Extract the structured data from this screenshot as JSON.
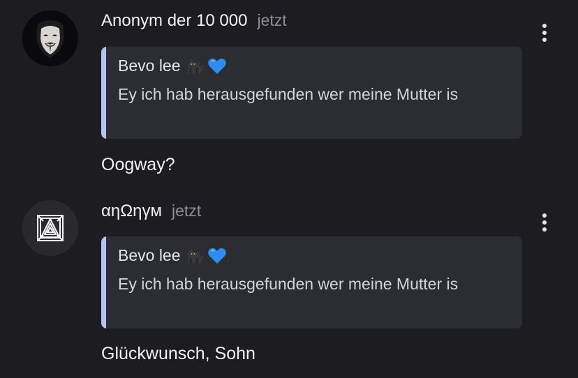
{
  "comments": [
    {
      "author": "Anonym der 10 000",
      "time": "jetzt",
      "avatar_icon": "guy-fawkes-mask-icon",
      "more_icon": "vertical-ellipsis-icon",
      "quote": {
        "author": "Bevo lee",
        "author_emojis": [
          "black-cat-emoji",
          "blue-heart-emoji"
        ],
        "text": "Ey ich hab herausgefunden wer meine Mutter is"
      },
      "text": "Oogway?"
    },
    {
      "author": "αηΩηγм",
      "time": "jetzt",
      "avatar_icon": "triangle-maze-logo-icon",
      "more_icon": "vertical-ellipsis-icon",
      "quote": {
        "author": "Bevo lee",
        "author_emojis": [
          "black-cat-emoji",
          "blue-heart-emoji"
        ],
        "text": "Ey ich hab herausgefunden wer meine Mutter is"
      },
      "text": "Glückwunsch, Sohn"
    }
  ],
  "colors": {
    "background": "#1c1c21",
    "quote_background": "#2c2c33",
    "quote_accent": "#b7c1f2",
    "muted_text": "#8d8d96"
  }
}
